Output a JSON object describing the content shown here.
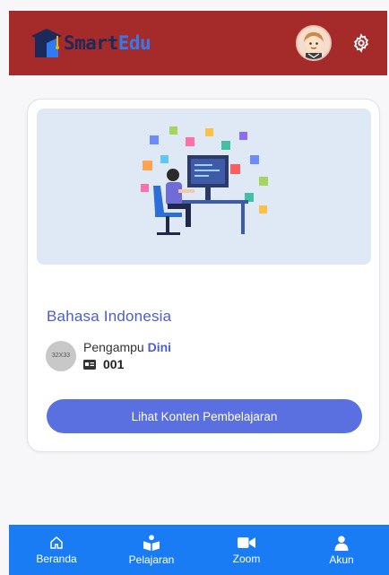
{
  "header": {
    "logo_smart": "Smart",
    "logo_edu": "Edu",
    "avatar_icon": "user-avatar",
    "settings_icon": "gear-icon",
    "bg_color": "#a52a2a"
  },
  "course": {
    "title": "Bahasa Indonesia",
    "teacher_prefix": "Pengampu",
    "teacher_name": "Dini",
    "avatar_placeholder": "32X33",
    "id_icon": "id-card-icon",
    "class_code": "001",
    "cta_label": "Lihat Konten Pembelajaran",
    "accent_color": "#4a5ed0"
  },
  "nav": {
    "bg_color": "#1a7cf5",
    "items": [
      {
        "label": "Beranda",
        "icon": "home-icon"
      },
      {
        "label": "Pelajaran",
        "icon": "reading-icon"
      },
      {
        "label": "Zoom",
        "icon": "video-camera-icon"
      },
      {
        "label": "Akun",
        "icon": "user-icon"
      }
    ]
  }
}
